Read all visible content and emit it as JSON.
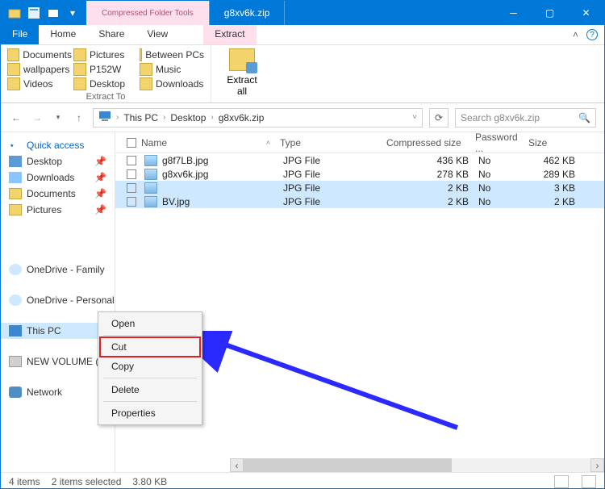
{
  "titlebar": {
    "context_tab_title": "Compressed Folder Tools",
    "window_title": "g8xv6k.zip"
  },
  "ribbon_tabs": {
    "file": "File",
    "home": "Home",
    "share": "Share",
    "view": "View",
    "extract": "Extract"
  },
  "ribbon": {
    "pins": [
      "Documents",
      "Pictures",
      "Between PCs",
      "wallpapers",
      "P152W",
      "Music",
      "Videos",
      "Desktop",
      "Downloads"
    ],
    "extract_to_label": "Extract To",
    "extract_all": "Extract\nall"
  },
  "nav": {
    "crumbs": [
      "This PC",
      "Desktop",
      "g8xv6k.zip"
    ],
    "search_placeholder": "Search g8xv6k.zip"
  },
  "tree": {
    "quick_access": "Quick access",
    "desktop": "Desktop",
    "downloads": "Downloads",
    "documents": "Documents",
    "pictures": "Pictures",
    "onedrive_family": "OneDrive - Family",
    "onedrive_personal": "OneDrive - Personal",
    "this_pc": "This PC",
    "new_volume": "NEW VOLUME (E:)",
    "network": "Network"
  },
  "columns": {
    "name": "Name",
    "type": "Type",
    "compressed_size": "Compressed size",
    "password": "Password ...",
    "size": "Size"
  },
  "rows": [
    {
      "name": "g8f7LB.jpg",
      "type": "JPG File",
      "csize": "436 KB",
      "pw": "No",
      "size": "462 KB",
      "state": ""
    },
    {
      "name": "g8xv6k.jpg",
      "type": "JPG File",
      "csize": "278 KB",
      "pw": "No",
      "size": "289 KB",
      "state": ""
    },
    {
      "name": "",
      "type": "JPG File",
      "csize": "2 KB",
      "pw": "No",
      "size": "3 KB",
      "state": "sel"
    },
    {
      "name": "BV.jpg",
      "type": "JPG File",
      "csize": "2 KB",
      "pw": "No",
      "size": "2 KB",
      "state": "sel"
    }
  ],
  "context_menu": {
    "open": "Open",
    "cut": "Cut",
    "copy": "Copy",
    "delete": "Delete",
    "properties": "Properties"
  },
  "status": {
    "items": "4 items",
    "selected": "2 items selected",
    "sel_size": "3.80 KB"
  }
}
